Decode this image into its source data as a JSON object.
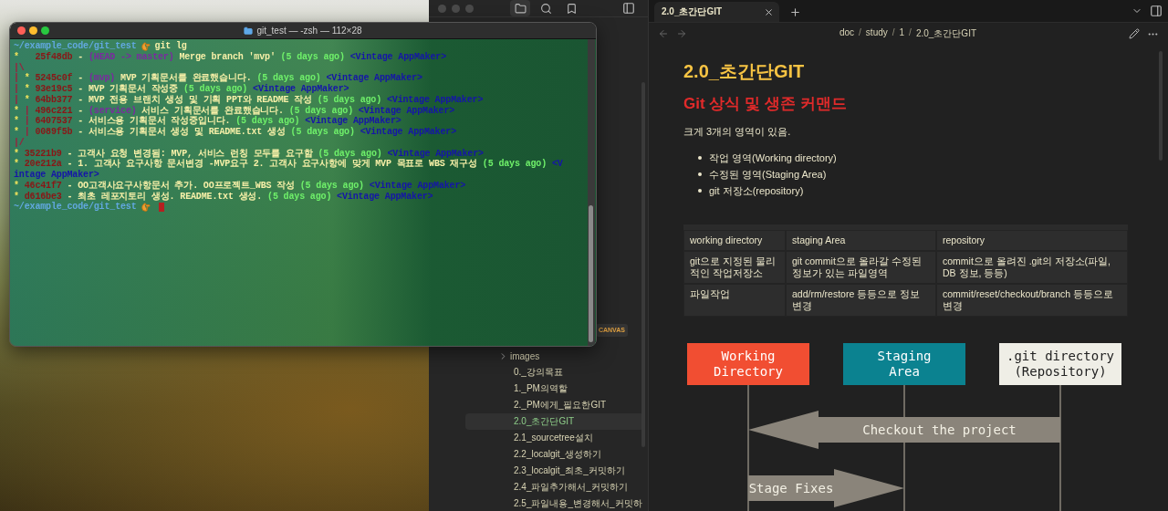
{
  "terminal": {
    "title": "git_test — -zsh — 112×28",
    "lines": [
      {
        "kind": "prompt",
        "path": "~/example_code/git_test",
        "command": "git lg"
      },
      {
        "kind": "log",
        "segments": [
          {
            "kind": "graph",
            "text": "*   "
          },
          {
            "kind": "hash",
            "text": "25f48db"
          },
          {
            "kind": "msg",
            "text": " - "
          },
          {
            "kind": "refs",
            "text": "(HEAD -> master)"
          },
          {
            "kind": "msg",
            "text": " Merge branch 'mvp' "
          },
          {
            "kind": "date",
            "text": "(5 days ago)"
          },
          {
            "kind": "author",
            "text": " <Vintage AppMaker>"
          }
        ]
      },
      {
        "kind": "log",
        "segments": [
          {
            "kind": "branch",
            "text": "|\\"
          }
        ]
      },
      {
        "kind": "log",
        "segments": [
          {
            "kind": "branch",
            "text": "| "
          },
          {
            "kind": "graph",
            "text": "* "
          },
          {
            "kind": "hash",
            "text": "5245c0f"
          },
          {
            "kind": "msg",
            "text": " - "
          },
          {
            "kind": "refs",
            "text": "(mvp)"
          },
          {
            "kind": "msg",
            "text": " MVP 기획문서를 완료했습니다. "
          },
          {
            "kind": "date",
            "text": "(5 days ago)"
          },
          {
            "kind": "author",
            "text": " <Vintage AppMaker>"
          }
        ]
      },
      {
        "kind": "log",
        "segments": [
          {
            "kind": "branch",
            "text": "| "
          },
          {
            "kind": "graph",
            "text": "* "
          },
          {
            "kind": "hash",
            "text": "93e19c5"
          },
          {
            "kind": "msg",
            "text": " - MVP 기획문서 작성중 "
          },
          {
            "kind": "date",
            "text": "(5 days ago)"
          },
          {
            "kind": "author",
            "text": " <Vintage AppMaker>"
          }
        ]
      },
      {
        "kind": "log",
        "segments": [
          {
            "kind": "branch",
            "text": "| "
          },
          {
            "kind": "graph",
            "text": "* "
          },
          {
            "kind": "hash",
            "text": "64bb377"
          },
          {
            "kind": "msg",
            "text": " - MVP 전용 브랜치 생성 및 기획 PPT와 README 작성 "
          },
          {
            "kind": "date",
            "text": "(5 days ago)"
          },
          {
            "kind": "author",
            "text": " <Vintage AppMaker>"
          }
        ]
      },
      {
        "kind": "log",
        "segments": [
          {
            "kind": "graph",
            "text": "* "
          },
          {
            "kind": "branch",
            "text": "| "
          },
          {
            "kind": "hash",
            "text": "496c221"
          },
          {
            "kind": "msg",
            "text": " - "
          },
          {
            "kind": "refs",
            "text": "(service)"
          },
          {
            "kind": "msg",
            "text": " 서비스 기획문서를 완료했습니다. "
          },
          {
            "kind": "date",
            "text": "(5 days ago)"
          },
          {
            "kind": "author",
            "text": " <Vintage AppMaker>"
          }
        ]
      },
      {
        "kind": "log",
        "segments": [
          {
            "kind": "graph",
            "text": "* "
          },
          {
            "kind": "branch",
            "text": "| "
          },
          {
            "kind": "hash",
            "text": "6407537"
          },
          {
            "kind": "msg",
            "text": " - 서비스용 기획문서 작성중입니다. "
          },
          {
            "kind": "date",
            "text": "(5 days ago)"
          },
          {
            "kind": "author",
            "text": " <Vintage AppMaker>"
          }
        ]
      },
      {
        "kind": "log",
        "segments": [
          {
            "kind": "graph",
            "text": "* "
          },
          {
            "kind": "branch",
            "text": "| "
          },
          {
            "kind": "hash",
            "text": "0089f5b"
          },
          {
            "kind": "msg",
            "text": " - 서비스용 기획문서 생성 및 README.txt 생성 "
          },
          {
            "kind": "date",
            "text": "(5 days ago)"
          },
          {
            "kind": "author",
            "text": " <Vintage AppMaker>"
          }
        ]
      },
      {
        "kind": "log",
        "segments": [
          {
            "kind": "branch",
            "text": "|/"
          }
        ]
      },
      {
        "kind": "log",
        "segments": [
          {
            "kind": "graph",
            "text": "* "
          },
          {
            "kind": "hash",
            "text": "35221b9"
          },
          {
            "kind": "msg",
            "text": " - 고객사 요청 변경됨: MVP, 서비스 런칭 모두를 요구함 "
          },
          {
            "kind": "date",
            "text": "(5 days ago)"
          },
          {
            "kind": "author",
            "text": " <Vintage AppMaker>"
          }
        ]
      },
      {
        "kind": "log",
        "segments": [
          {
            "kind": "graph",
            "text": "* "
          },
          {
            "kind": "hash",
            "text": "20e212a"
          },
          {
            "kind": "msg",
            "text": " - 1. 고객사 요구사항 문서변경 -MVP요구 2. 고객사 요구사항에 맞게 MVP 목표로 WBS 재구성 "
          },
          {
            "kind": "date",
            "text": "(5 days ago)"
          },
          {
            "kind": "author",
            "text": " <V"
          }
        ]
      },
      {
        "kind": "log",
        "segments": [
          {
            "kind": "author",
            "text": "intage AppMaker>"
          }
        ]
      },
      {
        "kind": "log",
        "segments": [
          {
            "kind": "graph",
            "text": "* "
          },
          {
            "kind": "hash",
            "text": "46c41f7"
          },
          {
            "kind": "msg",
            "text": " - OO고객사요구사항문서 추가. OO프로젝트_WBS 작성 "
          },
          {
            "kind": "date",
            "text": "(5 days ago)"
          },
          {
            "kind": "author",
            "text": " <Vintage AppMaker>"
          }
        ]
      },
      {
        "kind": "log",
        "segments": [
          {
            "kind": "graph",
            "text": "* "
          },
          {
            "kind": "hash",
            "text": "d616be3"
          },
          {
            "kind": "msg",
            "text": " - 최초 레포지토리 생성. README.txt 생성. "
          },
          {
            "kind": "date",
            "text": "(5 days ago)"
          },
          {
            "kind": "author",
            "text": " <Vintage AppMaker>"
          }
        ]
      },
      {
        "kind": "prompt",
        "path": "~/example_code/git_test",
        "cursor": true
      }
    ]
  },
  "sidebar": {
    "badge": "CANVAS",
    "items": [
      {
        "kind": "folder",
        "label": "images",
        "expanded": false,
        "selected": false
      },
      {
        "kind": "file",
        "label": "0._강의목표",
        "selected": false
      },
      {
        "kind": "file",
        "label": "1._PM의역할",
        "selected": false
      },
      {
        "kind": "file",
        "label": "2._PM에게_필요한GIT",
        "selected": false
      },
      {
        "kind": "file",
        "label": "2.0_초간단GIT",
        "selected": true
      },
      {
        "kind": "file",
        "label": "2.1_sourcetree설치",
        "selected": false
      },
      {
        "kind": "file",
        "label": "2.2_localgit_생성하기",
        "selected": false
      },
      {
        "kind": "file",
        "label": "2.3_localgit_최초_커밋하기",
        "selected": false
      },
      {
        "kind": "file",
        "label": "2.4_파일추가해서_커밋하기",
        "selected": false
      },
      {
        "kind": "file",
        "label": "2.5_파일내용_변경해서_커밋하",
        "selected": false
      }
    ]
  },
  "tabs": [
    {
      "label": "2.0_초간단GIT",
      "selected": true
    }
  ],
  "breadcrumb": [
    {
      "kind": "link",
      "text": "doc"
    },
    {
      "kind": "separator",
      "text": "/"
    },
    {
      "kind": "link",
      "text": "study"
    },
    {
      "kind": "separator",
      "text": "/"
    },
    {
      "kind": "link",
      "text": "1"
    },
    {
      "kind": "separator",
      "text": "/"
    },
    {
      "kind": "link",
      "text": "2.0_초간단GIT"
    }
  ],
  "document": {
    "title": "2.0_초간단GIT",
    "heading": "Git 상식 및 생존 커맨드",
    "paragraph": "크게 3개의 영역이 있음.",
    "bullets": [
      "작업 영역(Working directory)",
      "수정된 영역(Staging Area)",
      "git 저장소(repository)"
    ],
    "table": {
      "columns": [
        "working directory",
        "staging Area",
        "repository"
      ],
      "rows": [
        [
          "git으로 지정된 물리적인 작업저장소",
          "git commit으로 올라갈 수정된 정보가 있는 파일영역",
          "commit으로 올려진 .git의 저장소(파일, DB 정보, 등등)"
        ],
        [
          "파일작업",
          "add/rm/restore 등등으로 정보변경",
          "commit/reset/checkout/branch 등등으로 변경"
        ]
      ]
    },
    "diagram": {
      "boxes": [
        {
          "lines": [
            "Working",
            "Directory"
          ],
          "color": "#f14e32"
        },
        {
          "lines": [
            "Staging",
            "Area"
          ],
          "color": "#0b8290"
        },
        {
          "lines": [
            ".git directory",
            "(Repository)"
          ],
          "color": "#efeee6"
        }
      ],
      "arrows": [
        {
          "label": "Checkout the project"
        },
        {
          "label": "Stage Fixes"
        }
      ]
    }
  }
}
